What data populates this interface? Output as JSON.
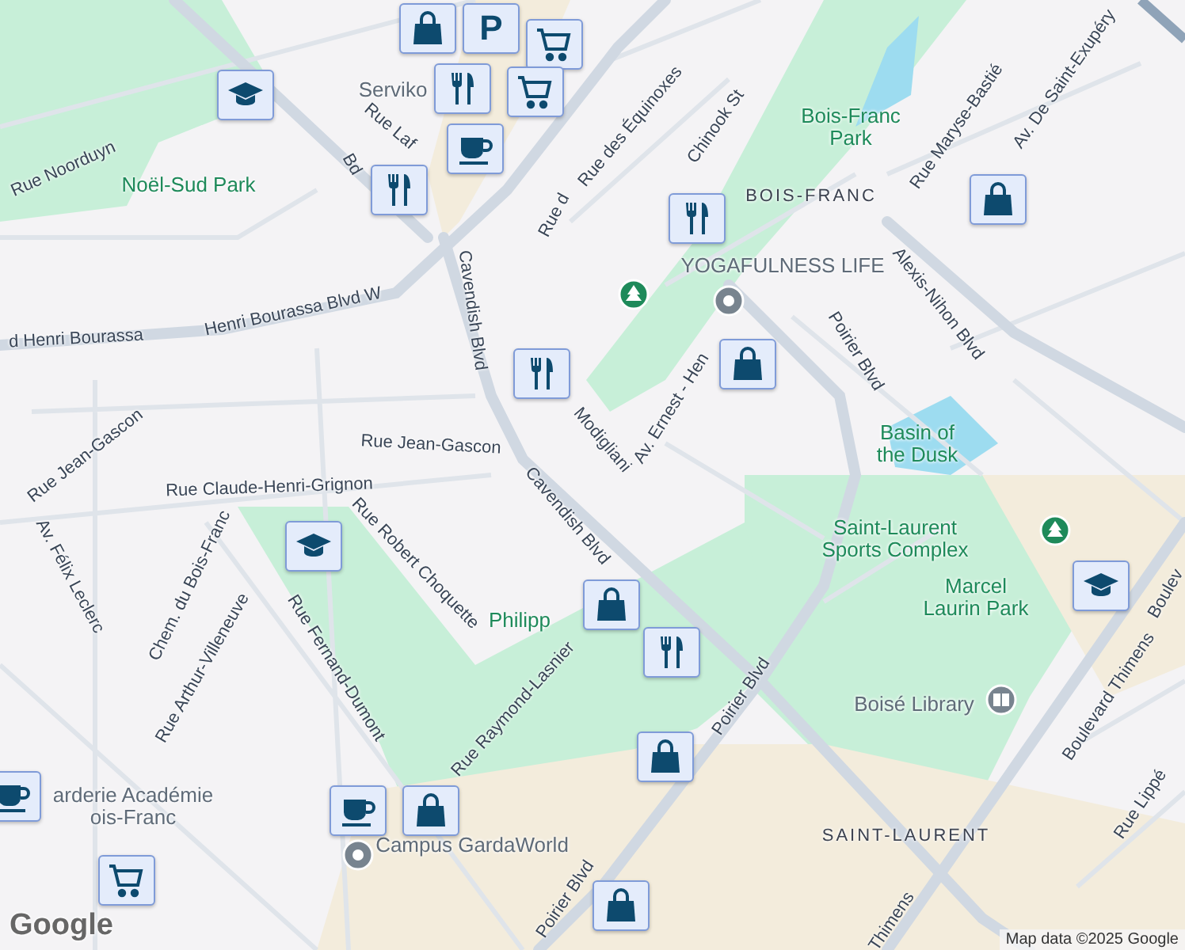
{
  "map": {
    "labels": [
      {
        "text": "Rue Noorduyn",
        "kind": "street"
      },
      {
        "text": "Bd",
        "kind": "street"
      },
      {
        "text": "Rue Laf",
        "kind": "street"
      },
      {
        "text": "Henri Bourassa Blvd W",
        "kind": "street"
      },
      {
        "text": "d Henri Bourassa",
        "kind": "street"
      },
      {
        "text": "Cavendish Blvd",
        "kind": "street"
      },
      {
        "text": "Rue Jean-Gascon",
        "kind": "street"
      },
      {
        "text": "Rue Jean-Gascon",
        "kind": "street"
      },
      {
        "text": "Rue Claude-Henri-Grignon",
        "kind": "street"
      },
      {
        "text": "Cavendish Blvd",
        "kind": "street"
      },
      {
        "text": "Modigliani",
        "kind": "street"
      },
      {
        "text": "Av. Ernest - Hen",
        "kind": "street"
      },
      {
        "text": "Rue des Équinoxes",
        "kind": "street"
      },
      {
        "text": "Chinook St",
        "kind": "street"
      },
      {
        "text": "Rue Maryse-Bastié",
        "kind": "street"
      },
      {
        "text": "Av. De Saint-Exupéry",
        "kind": "street"
      },
      {
        "text": "Alexis-Nihon Blvd",
        "kind": "street"
      },
      {
        "text": "Poirier Blvd",
        "kind": "street"
      },
      {
        "text": "Rue Robert Choquette",
        "kind": "street"
      },
      {
        "text": "Chem. du Bois-Franc",
        "kind": "street"
      },
      {
        "text": "Rue Arthur-Villeneuve",
        "kind": "street"
      },
      {
        "text": "Rue Fernand-Dumont",
        "kind": "street"
      },
      {
        "text": "Av. Félix Leclerc",
        "kind": "street"
      },
      {
        "text": "Rue Raymond-Lasnier",
        "kind": "street"
      },
      {
        "text": "Poirier Blvd",
        "kind": "street"
      },
      {
        "text": "Poirier Blvd",
        "kind": "street"
      },
      {
        "text": "Boulevard Thimens",
        "kind": "street"
      },
      {
        "text": "Boulev",
        "kind": "street"
      },
      {
        "text": "Thimens",
        "kind": "street"
      },
      {
        "text": "Rue Lippé",
        "kind": "street"
      },
      {
        "text": "Rue d",
        "kind": "street"
      },
      {
        "text": "Noël-Sud Park",
        "kind": "park"
      },
      {
        "text": "Bois-Franc\nPark",
        "kind": "park"
      },
      {
        "text": "BOIS-FRANC",
        "kind": "district"
      },
      {
        "text": "YOGAFULNESS LIFE",
        "kind": "place"
      },
      {
        "text": "Basin of\nthe Dusk",
        "kind": "park"
      },
      {
        "text": "Saint-Laurent\nSports Complex",
        "kind": "park"
      },
      {
        "text": "Marcel\nLaurin Park",
        "kind": "park"
      },
      {
        "text": "Boisé Library",
        "kind": "place"
      },
      {
        "text": "SAINT-LAURENT",
        "kind": "district"
      },
      {
        "text": "Philipp",
        "kind": "park"
      },
      {
        "text": "Serviko",
        "kind": "place"
      },
      {
        "text": "arderie Académie\nois-Franc",
        "kind": "place"
      },
      {
        "text": "Campus GardaWorld",
        "kind": "place"
      }
    ],
    "markers": [
      {
        "kind": "shop"
      },
      {
        "kind": "parking",
        "label": "P"
      },
      {
        "kind": "grocery"
      },
      {
        "kind": "grocery"
      },
      {
        "kind": "food"
      },
      {
        "kind": "cafe"
      },
      {
        "kind": "food"
      },
      {
        "kind": "school"
      },
      {
        "kind": "food"
      },
      {
        "kind": "school"
      },
      {
        "kind": "shop"
      },
      {
        "kind": "food"
      },
      {
        "kind": "shop"
      },
      {
        "kind": "cafe"
      },
      {
        "kind": "shop"
      },
      {
        "kind": "cafe"
      },
      {
        "kind": "grocery"
      },
      {
        "kind": "shop"
      },
      {
        "kind": "food"
      },
      {
        "kind": "shop"
      },
      {
        "kind": "shop"
      },
      {
        "kind": "school"
      }
    ],
    "pins": [
      {
        "kind": "park"
      },
      {
        "kind": "place"
      },
      {
        "kind": "park"
      },
      {
        "kind": "library"
      },
      {
        "kind": "place"
      }
    ],
    "logo": "Google",
    "attribution": "Map data ©2025 Google"
  }
}
